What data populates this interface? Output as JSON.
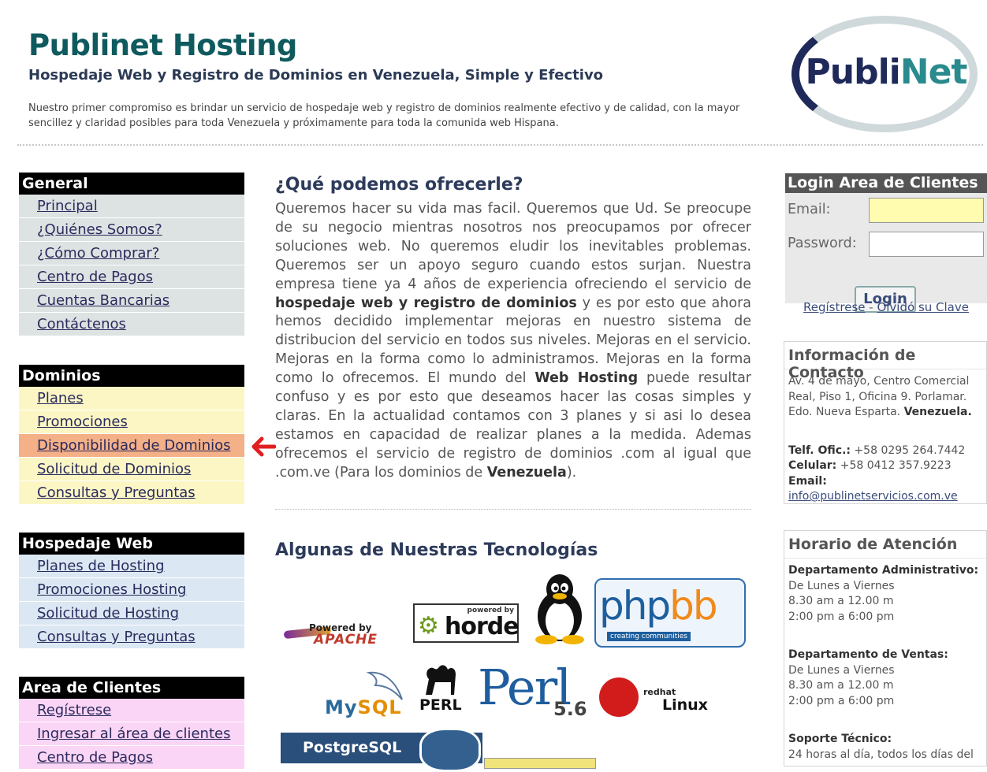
{
  "header": {
    "title": "Publinet Hosting",
    "subtitle": "Hospedaje Web y Registro de Dominios en Venezuela, Simple y Efectivo",
    "intro": "Nuestro primer compromiso es brindar un servicio de hospedaje web y registro de dominios realmente efectivo y de calidad, con la mayor sencillez y claridad posibles para toda Venezuela y próximamente para toda la comunida web Hispana.",
    "logo_text_a": "Publi",
    "logo_text_b": "Net"
  },
  "menus": {
    "general": {
      "title": "General",
      "items": [
        "Principal",
        "¿Quiénes Somos?",
        "¿Cómo Comprar?",
        "Centro de Pagos",
        "Cuentas Bancarias",
        "Contáctenos"
      ]
    },
    "dominios": {
      "title": "Dominios",
      "items": [
        "Planes",
        "Promociones",
        "Disponibilidad de Dominios",
        "Solicitud de Dominios",
        "Consultas y Preguntas"
      ],
      "active_index": 2
    },
    "hosting": {
      "title": "Hospedaje Web",
      "items": [
        "Planes de Hosting",
        "Promociones Hosting",
        "Solicitud de Hosting",
        "Consultas y Preguntas"
      ]
    },
    "clientes": {
      "title": "Area de Clientes",
      "items": [
        "Regístrese",
        "Ingresar al área de clientes",
        "Centro de Pagos"
      ]
    }
  },
  "main": {
    "title": "¿Qué podemos ofrecerle?",
    "p1": "Queremos hacer su vida mas facil. Queremos que Ud. Se preocupe de su negocio mientras nosotros nos preocupamos por ofrecer soluciones web. No queremos eludir los inevitables problemas. Queremos ser un apoyo seguro cuando estos surjan. Nuestra empresa tiene ya 4 años de experiencia ofreciendo el servicio de ",
    "b1": "hospedaje web y registro de dominios",
    "p2": " y es por esto que ahora hemos decidido implementar mejoras en nuestro sistema de distribucion del servicio en todos sus niveles. Mejoras en el servicio. Mejoras en la forma como lo administramos. Mejoras en la forma como lo ofrecemos. El mundo del ",
    "b2": "Web Hosting",
    "p3": " puede resultar confuso y es por esto que deseamos hacer las cosas simples y claras. En la actualidad contamos con 3 planes y si asi lo desea estamos en capacidad de realizar planes a la medida. Ademas ofrecemos el servicio de registro de dominios .com al igual que .com.ve (Para los dominios de ",
    "b3": "Venezuela",
    "p4": ").",
    "tech_title": "Algunas de Nuestras Tecnologías"
  },
  "tech_logos": {
    "apache_powered": "Powered by",
    "apache_name": "APACHE",
    "horde_powered": "powered by",
    "horde_name": "horde",
    "phpbb_a": "php",
    "phpbb_b": "bb",
    "phpbb_sub": "creating communities",
    "mysql_a": "My",
    "mysql_b": "SQL",
    "perl_label": "PERL",
    "perl_big": "Perl",
    "perl_version": "5.6",
    "redhat_small": "redhat",
    "redhat_linux": "Linux",
    "postgres": "PostgreSQL"
  },
  "login": {
    "title": "Login Area de Clientes",
    "email_label": "Email:",
    "password_label": "Password:",
    "button": "Login",
    "register_link": "Regístrese",
    "separator": " - ",
    "forgot_link": "Olvidó su Clave",
    "email_bg": "#fffcb0"
  },
  "contact": {
    "title": "Información de Contacto",
    "address": "Av. 4 de mayo, Centro Comercial Real, Piso 1, Oficina 9. Porlamar. Edo. Nueva Esparta. ",
    "address_bold": "Venezuela.",
    "phone_label": "Telf. Ofic.:",
    "phone": " +58 0295 264.7442",
    "cell_label": "Celular:",
    "cell": " +58 0412 357.9223",
    "email_label": "Email:",
    "email": "info@publinetservicios.com.ve"
  },
  "hours": {
    "title": "Horario de Atención",
    "admin_label": "Departamento Administrativo:",
    "admin_days": "De Lunes a Viernes",
    "admin_am": "8.30 am a 12.00 m",
    "admin_pm": "2:00 pm a 6:00 pm",
    "sales_label": "Departamento de Ventas:",
    "sales_days": "De Lunes a Viernes",
    "sales_am": "8.30 am a 12.00 m",
    "sales_pm": "2:00 pm a 6:00 pm",
    "support_label": "Soporte Técnico:",
    "support_text": "24 horas al día, todos los días del"
  },
  "colors": {
    "title": "#0f5a5e",
    "menu_head": "#000000",
    "active_item": "#f4b087",
    "arrow": "#e02020"
  }
}
